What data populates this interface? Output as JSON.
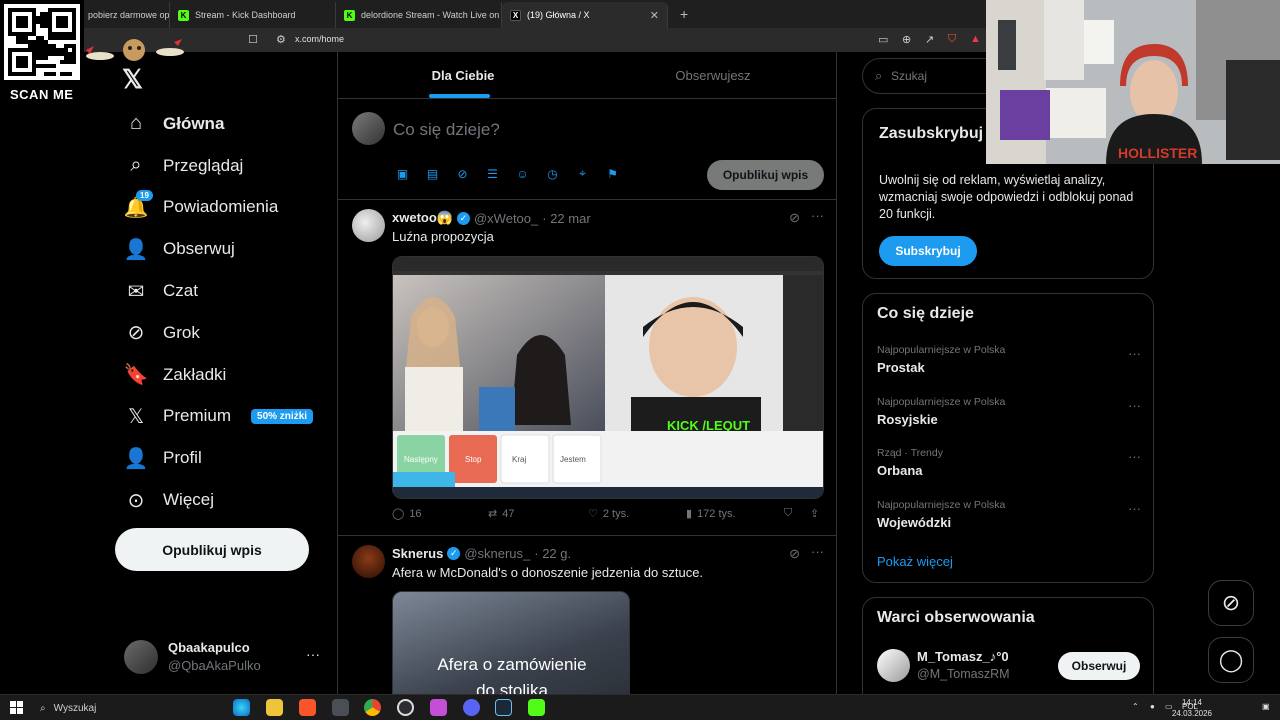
{
  "browser": {
    "tabs": [
      {
        "label": "pobierz darmowe oprogramowanie",
        "favicon": "generic"
      },
      {
        "label": "Stream - Kick Dashboard",
        "favicon": "kick"
      },
      {
        "label": "delordione Stream - Watch Live on Kick",
        "favicon": "kick"
      },
      {
        "label": "(19) Główna / X",
        "favicon": "x"
      }
    ],
    "url": "x.com/home"
  },
  "overlay": {
    "scan_label": "SCAN ME"
  },
  "sidebar": {
    "items": [
      {
        "label": "Główna",
        "icon": "home-icon",
        "glyph": "⌂"
      },
      {
        "label": "Przeglądaj",
        "icon": "search-icon",
        "glyph": "⌕"
      },
      {
        "label": "Powiadomienia",
        "icon": "bell-icon",
        "glyph": "🔔",
        "badge": "19"
      },
      {
        "label": "Obserwuj",
        "icon": "person-add-icon",
        "glyph": "👤"
      },
      {
        "label": "Czat",
        "icon": "mail-icon",
        "glyph": "✉"
      },
      {
        "label": "Grok",
        "icon": "grok-icon",
        "glyph": "⊘"
      },
      {
        "label": "Zakładki",
        "icon": "bookmark-icon",
        "glyph": "🔖"
      },
      {
        "label": "Premium",
        "icon": "x-icon",
        "glyph": "𝕏",
        "tag": "50% zniżki"
      },
      {
        "label": "Profil",
        "icon": "profile-icon",
        "glyph": "👤"
      },
      {
        "label": "Więcej",
        "icon": "more-circle-icon",
        "glyph": "⊙"
      }
    ],
    "post_button": "Opublikuj wpis",
    "account": {
      "name": "Qbaakapulco",
      "handle": "@QbaAkaPulko",
      "more": "···"
    }
  },
  "feed": {
    "tabs": [
      "Dla Ciebie",
      "Obserwujesz"
    ],
    "composer": {
      "placeholder": "Co się dzieje?",
      "post_button": "Opublikuj wpis"
    },
    "posts": [
      {
        "name": "xwetoo😱",
        "handle": "@xWetoo_",
        "time": "· 22 mar",
        "text": "Luźna propozycja",
        "media": {
          "stream_overlay": "KICK /LEQUT",
          "buttons": [
            "Następny",
            "Stop",
            "Kraj",
            "Jestem"
          ]
        },
        "stats": {
          "replies": "16",
          "reposts": "47",
          "likes": "2 tys.",
          "views": "172 tys."
        }
      },
      {
        "name": "Sknerus",
        "handle": "@sknerus_",
        "time": "· 22 g.",
        "text": "Afera w McDonald's o donoszenie jedzenia do sztuce.",
        "media": {
          "caption_line1": "Afera o zamówienie",
          "caption_line2": "do stolika"
        }
      }
    ]
  },
  "right": {
    "search_placeholder": "Szukaj",
    "premium": {
      "title": "Zasubskrybuj Premium",
      "description": "Uwolnij się od reklam, wyświetlaj analizy, wzmacniaj swoje odpowiedzi i odblokuj ponad 20 funkcji.",
      "button": "Subskrybuj"
    },
    "trends": {
      "title": "Co się dzieje",
      "items": [
        {
          "meta": "Najpopularniejsze w Polska",
          "name": "Prostak"
        },
        {
          "meta": "Najpopularniejsze w Polska",
          "name": "Rosyjskie"
        },
        {
          "meta": "Rząd · Trendy",
          "name": "Orbana"
        },
        {
          "meta": "Najpopularniejsze w Polska",
          "name": "Wojewódzki"
        }
      ],
      "show_more": "Pokaż więcej"
    },
    "who_to_follow": {
      "title": "Warci obserwowania",
      "name": "M_Tomasz_♪°0",
      "handle": "@M_TomaszRM",
      "button": "Obserwuj"
    }
  },
  "webcam": {
    "shirt_text": "HOLLISTER"
  },
  "taskbar": {
    "search": "Wyszukaj",
    "lang": "POL",
    "time": "14:14",
    "date": "24.03.2026"
  },
  "colors": {
    "accent": "#1d9bf0",
    "background": "#000000",
    "kick": "#53fc18"
  }
}
